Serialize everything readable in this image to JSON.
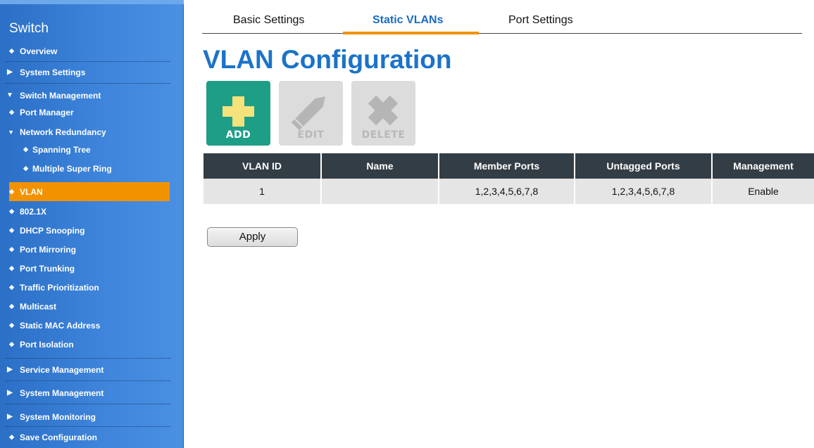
{
  "sidebar": {
    "title": "Switch",
    "items": [
      {
        "label": "Overview",
        "marker": "◆"
      },
      {
        "label": "System Settings",
        "marker": "▶"
      },
      {
        "label": "Switch Management",
        "marker": "▼"
      },
      {
        "label": "Port Manager",
        "marker": "◆"
      },
      {
        "label": "Network Redundancy",
        "marker": "▼"
      },
      {
        "label": "Spanning Tree",
        "marker": "◆"
      },
      {
        "label": "Multiple Super Ring",
        "marker": "◆"
      },
      {
        "label": "VLAN",
        "marker": "◆"
      },
      {
        "label": "802.1X",
        "marker": "◆"
      },
      {
        "label": "DHCP Snooping",
        "marker": "◆"
      },
      {
        "label": "Port Mirroring",
        "marker": "◆"
      },
      {
        "label": "Port Trunking",
        "marker": "◆"
      },
      {
        "label": "Traffic Prioritization",
        "marker": "◆"
      },
      {
        "label": "Multicast",
        "marker": "◆"
      },
      {
        "label": "Static MAC Address",
        "marker": "◆"
      },
      {
        "label": "Port Isolation",
        "marker": "◆"
      },
      {
        "label": "Service Management",
        "marker": "▶"
      },
      {
        "label": "System Management",
        "marker": "▶"
      },
      {
        "label": "System Monitoring",
        "marker": "▶"
      },
      {
        "label": "Save Configuration",
        "marker": "◆"
      }
    ],
    "active_item": "VLAN"
  },
  "tabs": [
    {
      "label": "Basic Settings"
    },
    {
      "label": "Static VLANs",
      "active": true
    },
    {
      "label": "Port Settings"
    }
  ],
  "page_title": "VLAN Configuration",
  "toolbar": {
    "add_label": "ADD",
    "edit_label": "EDIT",
    "delete_label": "DELETE"
  },
  "table": {
    "headers": [
      "VLAN ID",
      "Name",
      "Member Ports",
      "Untagged Ports",
      "Management"
    ],
    "rows": [
      [
        "1",
        "",
        "1,2,3,4,5,6,7,8",
        "1,2,3,4,5,6,7,8",
        "Enable"
      ]
    ]
  },
  "apply_label": "Apply",
  "colors": {
    "sidebar": "#3f86dc",
    "active": "#f39200",
    "title": "#1b73c8",
    "add_button": "#1e9e87",
    "add_plus": "#f5e27a",
    "table_header": "#333d45"
  }
}
